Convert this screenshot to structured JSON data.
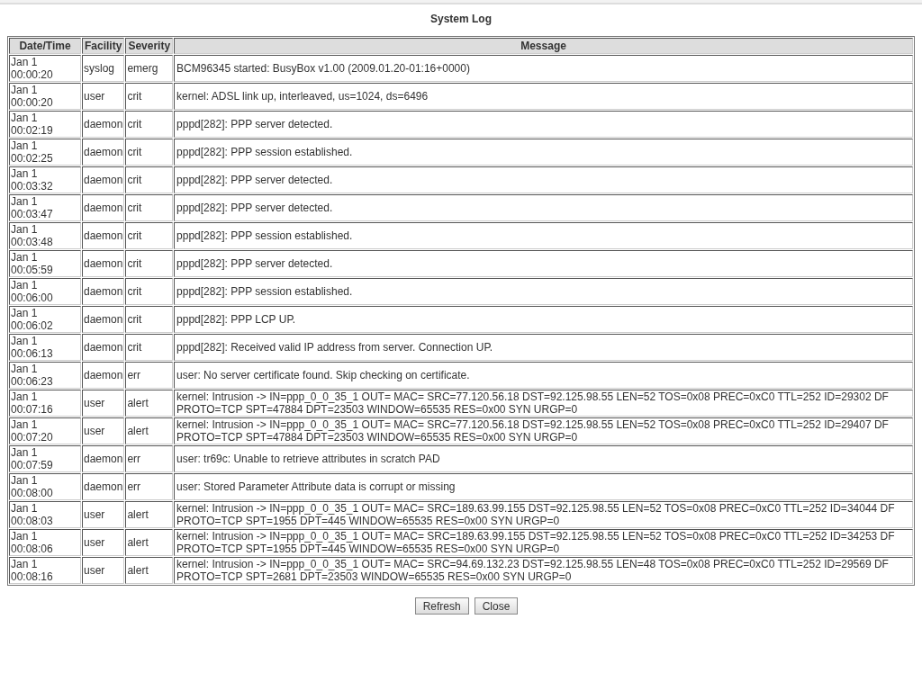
{
  "title": "System Log",
  "table": {
    "columns": [
      "Date/Time",
      "Facility",
      "Severity",
      "Message"
    ],
    "rows": [
      {
        "date": "Jan 1",
        "time": "00:00:20",
        "facility": "syslog",
        "severity": "emerg",
        "message": "BCM96345 started: BusyBox v1.00 (2009.01.20-01:16+0000)"
      },
      {
        "date": "Jan 1",
        "time": "00:00:20",
        "facility": "user",
        "severity": "crit",
        "message": "kernel: ADSL link up, interleaved, us=1024, ds=6496"
      },
      {
        "date": "Jan 1",
        "time": "00:02:19",
        "facility": "daemon",
        "severity": "crit",
        "message": "pppd[282]: PPP server detected."
      },
      {
        "date": "Jan 1",
        "time": "00:02:25",
        "facility": "daemon",
        "severity": "crit",
        "message": "pppd[282]: PPP session established."
      },
      {
        "date": "Jan 1",
        "time": "00:03:32",
        "facility": "daemon",
        "severity": "crit",
        "message": "pppd[282]: PPP server detected."
      },
      {
        "date": "Jan 1",
        "time": "00:03:47",
        "facility": "daemon",
        "severity": "crit",
        "message": "pppd[282]: PPP server detected."
      },
      {
        "date": "Jan 1",
        "time": "00:03:48",
        "facility": "daemon",
        "severity": "crit",
        "message": "pppd[282]: PPP session established."
      },
      {
        "date": "Jan 1",
        "time": "00:05:59",
        "facility": "daemon",
        "severity": "crit",
        "message": "pppd[282]: PPP server detected."
      },
      {
        "date": "Jan 1",
        "time": "00:06:00",
        "facility": "daemon",
        "severity": "crit",
        "message": "pppd[282]: PPP session established."
      },
      {
        "date": "Jan 1",
        "time": "00:06:02",
        "facility": "daemon",
        "severity": "crit",
        "message": "pppd[282]: PPP LCP UP."
      },
      {
        "date": "Jan 1",
        "time": "00:06:13",
        "facility": "daemon",
        "severity": "crit",
        "message": "pppd[282]: Received valid IP address from server. Connection UP."
      },
      {
        "date": "Jan 1",
        "time": "00:06:23",
        "facility": "daemon",
        "severity": "err",
        "message": "user: No server certificate found. Skip checking on certificate."
      },
      {
        "date": "Jan 1",
        "time": "00:07:16",
        "facility": "user",
        "severity": "alert",
        "message": "kernel: Intrusion -> IN=ppp_0_0_35_1 OUT= MAC= SRC=77.120.56.18 DST=92.125.98.55 LEN=52 TOS=0x08 PREC=0xC0 TTL=252 ID=29302 DF PROTO=TCP SPT=47884 DPT=23503 WINDOW=65535 RES=0x00 SYN URGP=0"
      },
      {
        "date": "Jan 1",
        "time": "00:07:20",
        "facility": "user",
        "severity": "alert",
        "message": "kernel: Intrusion -> IN=ppp_0_0_35_1 OUT= MAC= SRC=77.120.56.18 DST=92.125.98.55 LEN=52 TOS=0x08 PREC=0xC0 TTL=252 ID=29407 DF PROTO=TCP SPT=47884 DPT=23503 WINDOW=65535 RES=0x00 SYN URGP=0"
      },
      {
        "date": "Jan 1",
        "time": "00:07:59",
        "facility": "daemon",
        "severity": "err",
        "message": "user: tr69c: Unable to retrieve attributes in scratch PAD"
      },
      {
        "date": "Jan 1",
        "time": "00:08:00",
        "facility": "daemon",
        "severity": "err",
        "message": "user: Stored Parameter Attribute data is corrupt or missing"
      },
      {
        "date": "Jan 1",
        "time": "00:08:03",
        "facility": "user",
        "severity": "alert",
        "message": "kernel: Intrusion -> IN=ppp_0_0_35_1 OUT= MAC= SRC=189.63.99.155 DST=92.125.98.55 LEN=52 TOS=0x08 PREC=0xC0 TTL=252 ID=34044 DF PROTO=TCP SPT=1955 DPT=445 WINDOW=65535 RES=0x00 SYN URGP=0"
      },
      {
        "date": "Jan 1",
        "time": "00:08:06",
        "facility": "user",
        "severity": "alert",
        "message": "kernel: Intrusion -> IN=ppp_0_0_35_1 OUT= MAC= SRC=189.63.99.155 DST=92.125.98.55 LEN=52 TOS=0x08 PREC=0xC0 TTL=252 ID=34253 DF PROTO=TCP SPT=1955 DPT=445 WINDOW=65535 RES=0x00 SYN URGP=0"
      },
      {
        "date": "Jan 1",
        "time": "00:08:16",
        "facility": "user",
        "severity": "alert",
        "message": "kernel: Intrusion -> IN=ppp_0_0_35_1 OUT= MAC= SRC=94.69.132.23 DST=92.125.98.55 LEN=48 TOS=0x08 PREC=0xC0 TTL=252 ID=29569 DF PROTO=TCP SPT=2681 DPT=23503 WINDOW=65535 RES=0x00 SYN URGP=0"
      }
    ]
  },
  "buttons": [
    "Refresh",
    "Close"
  ]
}
